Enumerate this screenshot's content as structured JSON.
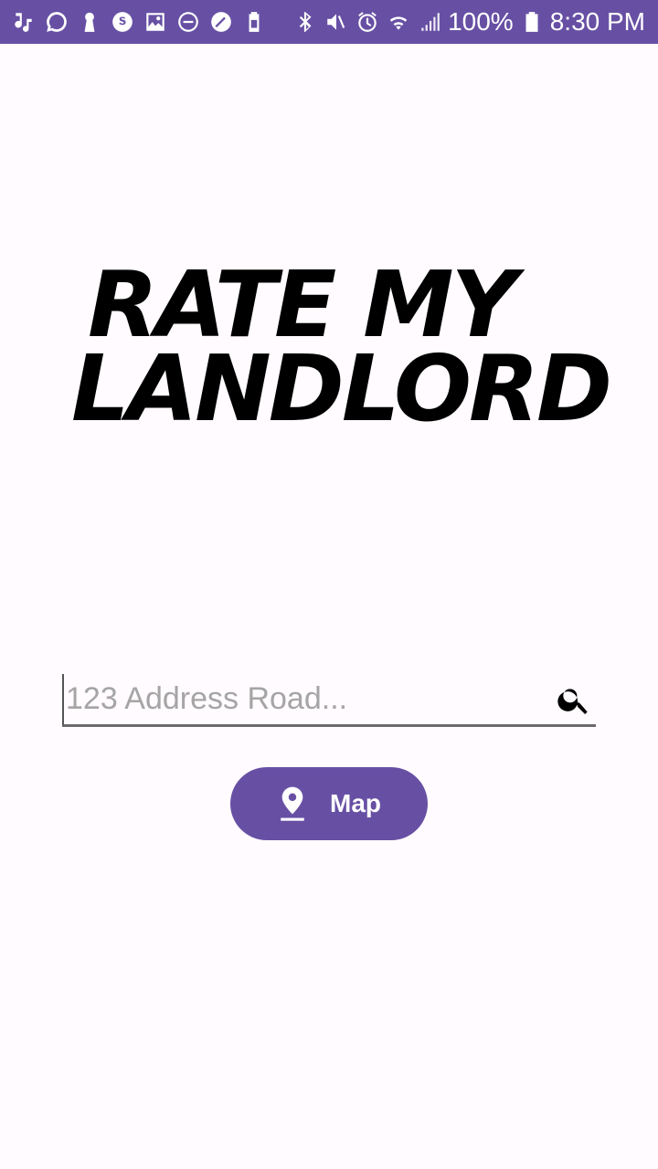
{
  "status_bar": {
    "battery_percent": "100%",
    "time": "8:30 PM",
    "left_icons": [
      "music-note-icon",
      "signal-messenger-icon",
      "keyhole-icon",
      "skype-icon",
      "gallery-icon",
      "do-not-disturb-icon",
      "speedometer-icon",
      "battery-saver-icon"
    ],
    "right_icons": [
      "bluetooth-icon",
      "mute-icon",
      "alarm-icon",
      "wifi-icon",
      "cell-signal-icon",
      "battery-icon"
    ],
    "background": "#6750a4"
  },
  "app": {
    "title_line_1": "RATE MY",
    "title_line_2": "LANDLORD"
  },
  "search": {
    "placeholder": "123 Address Road...",
    "icon": "search-icon"
  },
  "map_button": {
    "label": "Map",
    "icon": "location-pin-icon",
    "color": "#6750a4"
  }
}
